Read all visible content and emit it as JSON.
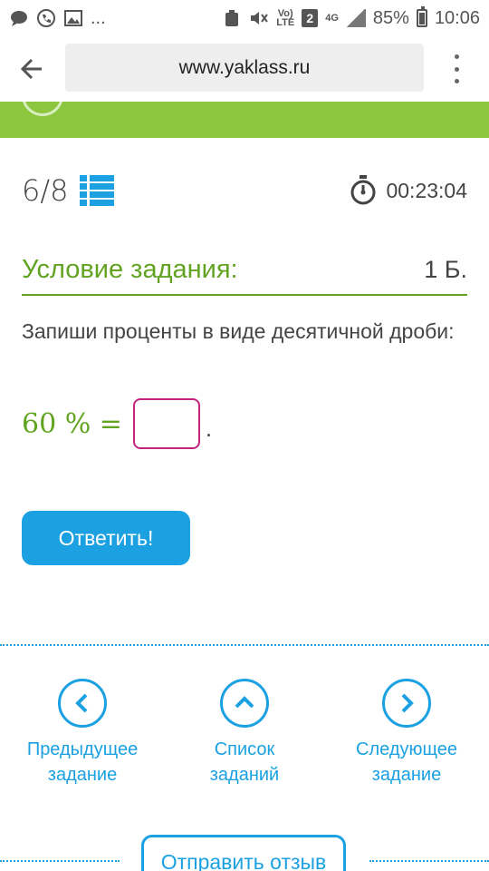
{
  "status_bar": {
    "more": "...",
    "network_top": "Vo)",
    "network_bottom": "LTE",
    "sim_slot": "2",
    "data_type": "4G",
    "battery": "85%",
    "time": "10:06"
  },
  "browser": {
    "url": "www.yaklass.ru",
    "icons": {
      "back": "arrow-left-icon",
      "menu": "kebab-menu-icon"
    }
  },
  "progress": {
    "current": "6",
    "total": "8",
    "separator": "/",
    "timer": "00:23:04"
  },
  "condition": {
    "title": "Условие задания:",
    "score": "1 Б."
  },
  "task": {
    "text": "Запиши проценты в виде десятичной дроби:",
    "equation_lhs": "60 % =",
    "answer_value": "",
    "trailing": "."
  },
  "answer_button": {
    "label": "Ответить!"
  },
  "navigation": {
    "prev": {
      "line1": "Предыдущее",
      "line2": "задание"
    },
    "list": {
      "line1": "Список",
      "line2": "заданий"
    },
    "next": {
      "line1": "Следующее",
      "line2": "задание"
    }
  },
  "feedback": {
    "label": "Отправить отзыв"
  },
  "colors": {
    "accent_blue": "#1ba1e2",
    "accent_green": "#62a422",
    "band_green": "#8cc63f",
    "input_border": "#c2237e"
  }
}
